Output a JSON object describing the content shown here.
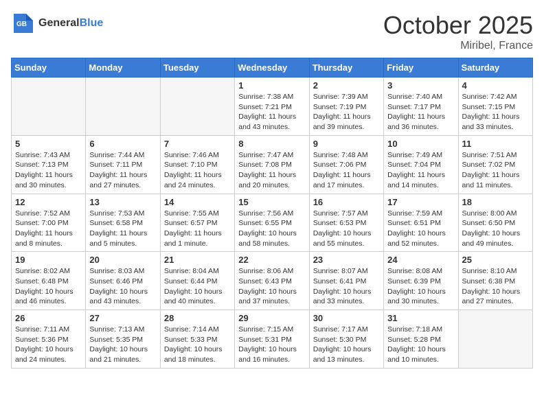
{
  "header": {
    "logo_general": "General",
    "logo_blue": "Blue",
    "month": "October 2025",
    "location": "Miribel, France"
  },
  "days_of_week": [
    "Sunday",
    "Monday",
    "Tuesday",
    "Wednesday",
    "Thursday",
    "Friday",
    "Saturday"
  ],
  "weeks": [
    [
      {
        "day": "",
        "empty": true
      },
      {
        "day": "",
        "empty": true
      },
      {
        "day": "",
        "empty": true
      },
      {
        "day": "1",
        "sunrise": "Sunrise: 7:38 AM",
        "sunset": "Sunset: 7:21 PM",
        "daylight": "Daylight: 11 hours and 43 minutes."
      },
      {
        "day": "2",
        "sunrise": "Sunrise: 7:39 AM",
        "sunset": "Sunset: 7:19 PM",
        "daylight": "Daylight: 11 hours and 39 minutes."
      },
      {
        "day": "3",
        "sunrise": "Sunrise: 7:40 AM",
        "sunset": "Sunset: 7:17 PM",
        "daylight": "Daylight: 11 hours and 36 minutes."
      },
      {
        "day": "4",
        "sunrise": "Sunrise: 7:42 AM",
        "sunset": "Sunset: 7:15 PM",
        "daylight": "Daylight: 11 hours and 33 minutes."
      }
    ],
    [
      {
        "day": "5",
        "sunrise": "Sunrise: 7:43 AM",
        "sunset": "Sunset: 7:13 PM",
        "daylight": "Daylight: 11 hours and 30 minutes."
      },
      {
        "day": "6",
        "sunrise": "Sunrise: 7:44 AM",
        "sunset": "Sunset: 7:11 PM",
        "daylight": "Daylight: 11 hours and 27 minutes."
      },
      {
        "day": "7",
        "sunrise": "Sunrise: 7:46 AM",
        "sunset": "Sunset: 7:10 PM",
        "daylight": "Daylight: 11 hours and 24 minutes."
      },
      {
        "day": "8",
        "sunrise": "Sunrise: 7:47 AM",
        "sunset": "Sunset: 7:08 PM",
        "daylight": "Daylight: 11 hours and 20 minutes."
      },
      {
        "day": "9",
        "sunrise": "Sunrise: 7:48 AM",
        "sunset": "Sunset: 7:06 PM",
        "daylight": "Daylight: 11 hours and 17 minutes."
      },
      {
        "day": "10",
        "sunrise": "Sunrise: 7:49 AM",
        "sunset": "Sunset: 7:04 PM",
        "daylight": "Daylight: 11 hours and 14 minutes."
      },
      {
        "day": "11",
        "sunrise": "Sunrise: 7:51 AM",
        "sunset": "Sunset: 7:02 PM",
        "daylight": "Daylight: 11 hours and 11 minutes."
      }
    ],
    [
      {
        "day": "12",
        "sunrise": "Sunrise: 7:52 AM",
        "sunset": "Sunset: 7:00 PM",
        "daylight": "Daylight: 11 hours and 8 minutes."
      },
      {
        "day": "13",
        "sunrise": "Sunrise: 7:53 AM",
        "sunset": "Sunset: 6:58 PM",
        "daylight": "Daylight: 11 hours and 5 minutes."
      },
      {
        "day": "14",
        "sunrise": "Sunrise: 7:55 AM",
        "sunset": "Sunset: 6:57 PM",
        "daylight": "Daylight: 11 hours and 1 minute."
      },
      {
        "day": "15",
        "sunrise": "Sunrise: 7:56 AM",
        "sunset": "Sunset: 6:55 PM",
        "daylight": "Daylight: 10 hours and 58 minutes."
      },
      {
        "day": "16",
        "sunrise": "Sunrise: 7:57 AM",
        "sunset": "Sunset: 6:53 PM",
        "daylight": "Daylight: 10 hours and 55 minutes."
      },
      {
        "day": "17",
        "sunrise": "Sunrise: 7:59 AM",
        "sunset": "Sunset: 6:51 PM",
        "daylight": "Daylight: 10 hours and 52 minutes."
      },
      {
        "day": "18",
        "sunrise": "Sunrise: 8:00 AM",
        "sunset": "Sunset: 6:50 PM",
        "daylight": "Daylight: 10 hours and 49 minutes."
      }
    ],
    [
      {
        "day": "19",
        "sunrise": "Sunrise: 8:02 AM",
        "sunset": "Sunset: 6:48 PM",
        "daylight": "Daylight: 10 hours and 46 minutes."
      },
      {
        "day": "20",
        "sunrise": "Sunrise: 8:03 AM",
        "sunset": "Sunset: 6:46 PM",
        "daylight": "Daylight: 10 hours and 43 minutes."
      },
      {
        "day": "21",
        "sunrise": "Sunrise: 8:04 AM",
        "sunset": "Sunset: 6:44 PM",
        "daylight": "Daylight: 10 hours and 40 minutes."
      },
      {
        "day": "22",
        "sunrise": "Sunrise: 8:06 AM",
        "sunset": "Sunset: 6:43 PM",
        "daylight": "Daylight: 10 hours and 37 minutes."
      },
      {
        "day": "23",
        "sunrise": "Sunrise: 8:07 AM",
        "sunset": "Sunset: 6:41 PM",
        "daylight": "Daylight: 10 hours and 33 minutes."
      },
      {
        "day": "24",
        "sunrise": "Sunrise: 8:08 AM",
        "sunset": "Sunset: 6:39 PM",
        "daylight": "Daylight: 10 hours and 30 minutes."
      },
      {
        "day": "25",
        "sunrise": "Sunrise: 8:10 AM",
        "sunset": "Sunset: 6:38 PM",
        "daylight": "Daylight: 10 hours and 27 minutes."
      }
    ],
    [
      {
        "day": "26",
        "sunrise": "Sunrise: 7:11 AM",
        "sunset": "Sunset: 5:36 PM",
        "daylight": "Daylight: 10 hours and 24 minutes."
      },
      {
        "day": "27",
        "sunrise": "Sunrise: 7:13 AM",
        "sunset": "Sunset: 5:35 PM",
        "daylight": "Daylight: 10 hours and 21 minutes."
      },
      {
        "day": "28",
        "sunrise": "Sunrise: 7:14 AM",
        "sunset": "Sunset: 5:33 PM",
        "daylight": "Daylight: 10 hours and 18 minutes."
      },
      {
        "day": "29",
        "sunrise": "Sunrise: 7:15 AM",
        "sunset": "Sunset: 5:31 PM",
        "daylight": "Daylight: 10 hours and 16 minutes."
      },
      {
        "day": "30",
        "sunrise": "Sunrise: 7:17 AM",
        "sunset": "Sunset: 5:30 PM",
        "daylight": "Daylight: 10 hours and 13 minutes."
      },
      {
        "day": "31",
        "sunrise": "Sunrise: 7:18 AM",
        "sunset": "Sunset: 5:28 PM",
        "daylight": "Daylight: 10 hours and 10 minutes."
      },
      {
        "day": "",
        "empty": true
      }
    ]
  ]
}
